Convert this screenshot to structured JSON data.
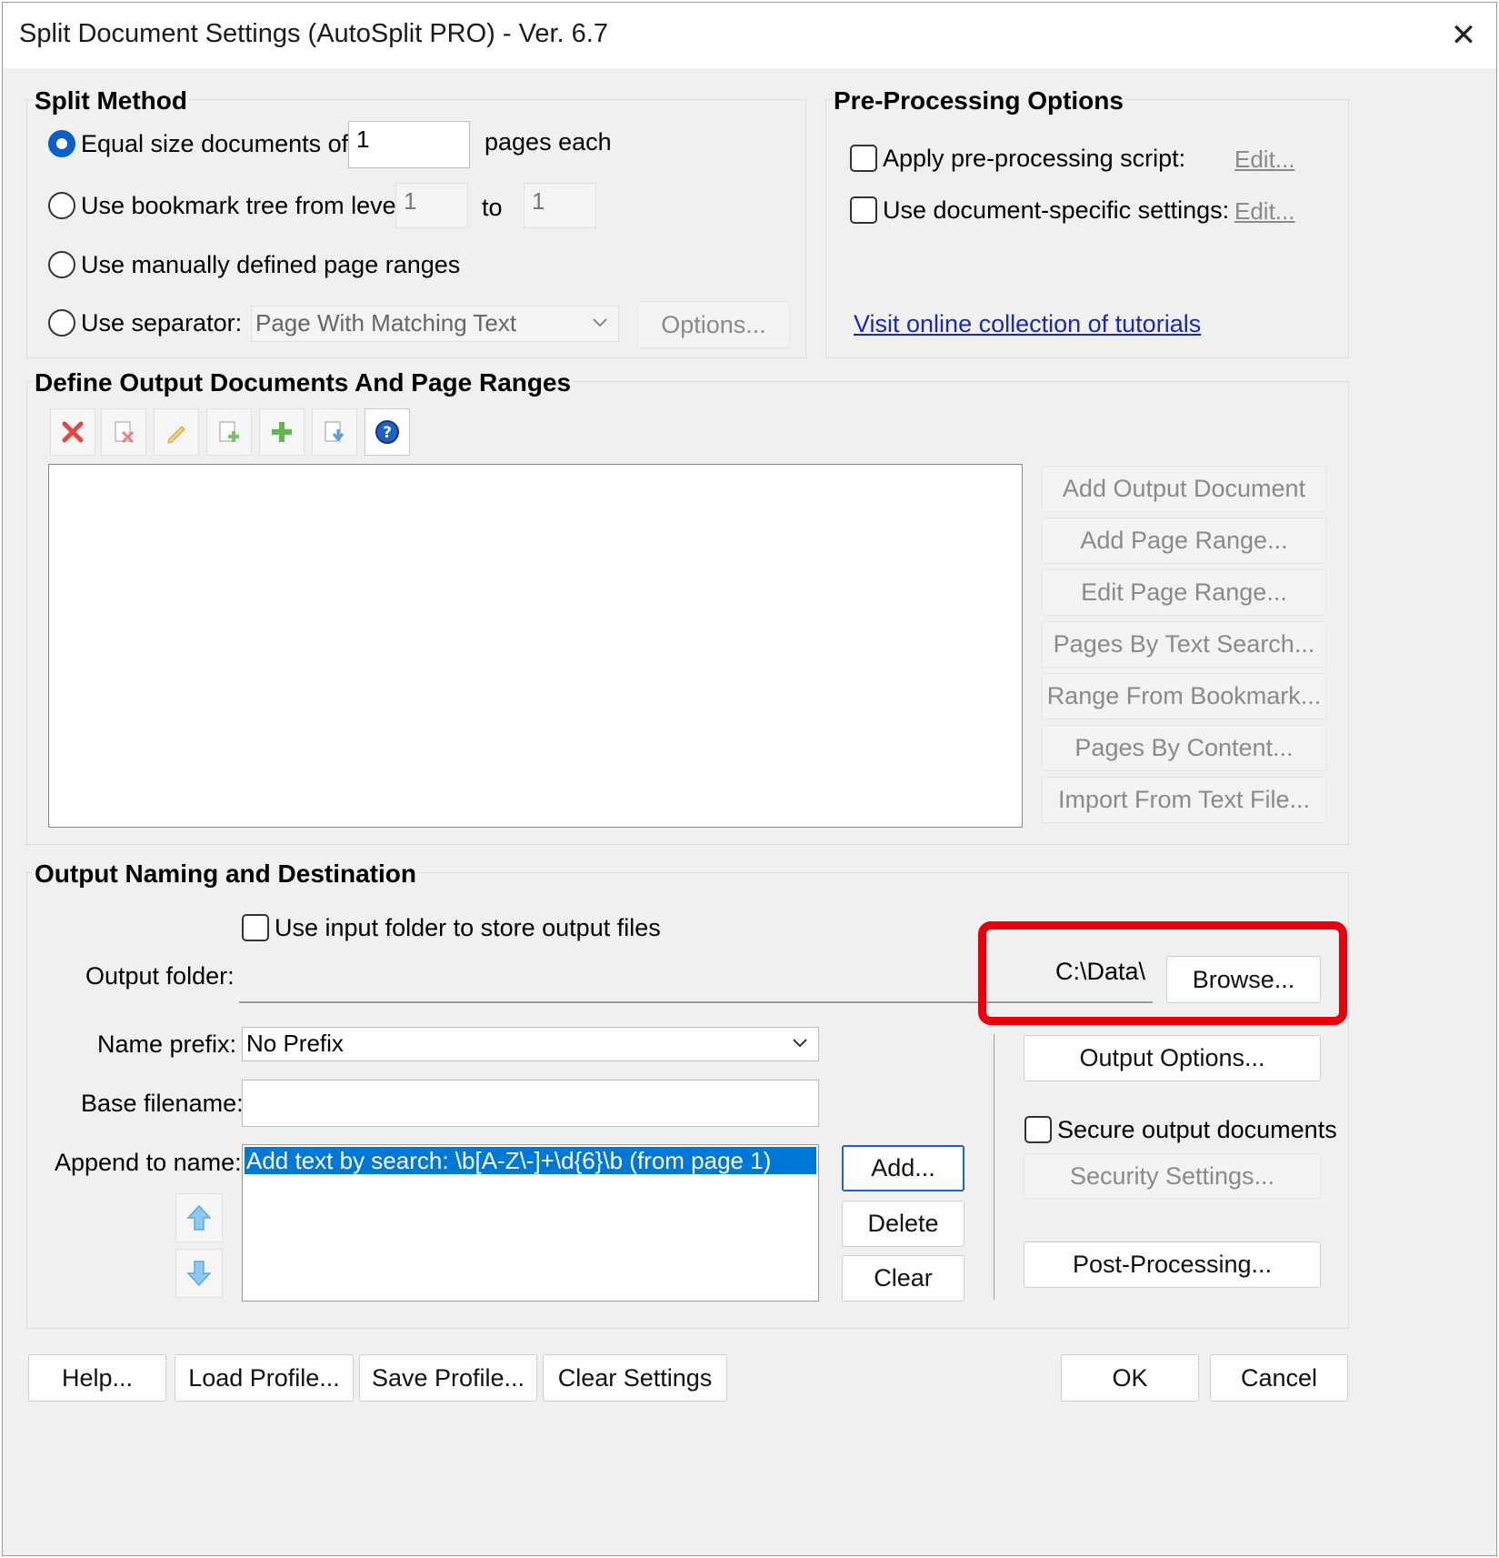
{
  "window": {
    "title": "Split Document Settings (AutoSplit PRO) - Ver. 6.7",
    "close_glyph": "✕"
  },
  "split_method": {
    "title": "Split Method",
    "equal_size_label": "Equal size documents of",
    "equal_size_value": "1",
    "pages_each_label": "pages each",
    "bookmark_label": "Use bookmark tree from level",
    "bookmark_from": "1",
    "to_label": "to",
    "bookmark_to": "1",
    "manual_label": "Use manually defined page ranges",
    "separator_label": "Use separator:",
    "separator_value": "Page With Matching Text",
    "options_button": "Options..."
  },
  "preprocessing": {
    "title": "Pre-Processing Options",
    "script_label": "Apply pre-processing script:",
    "script_edit": "Edit...",
    "doc_specific_label": "Use document-specific settings:",
    "doc_specific_edit": "Edit...",
    "tutorials_link": "Visit online collection of tutorials"
  },
  "define_output": {
    "title": "Define Output Documents And Page Ranges",
    "toolbar_icons": [
      "delete-icon",
      "delete-document-icon",
      "edit-pencil-icon",
      "add-document-icon",
      "add-plus-icon",
      "import-icon",
      "help-icon"
    ],
    "side_buttons": [
      "Add Output Document",
      "Add Page Range...",
      "Edit Page Range...",
      "Pages By Text Search...",
      "Range From Bookmark...",
      "Pages By Content...",
      "Import From Text File..."
    ]
  },
  "output_naming": {
    "title": "Output Naming and Destination",
    "use_input_folder_label": "Use input folder to store output files",
    "output_folder_label": "Output folder:",
    "output_folder_value": "C:\\Data\\",
    "browse_button": "Browse...",
    "name_prefix_label": "Name prefix:",
    "name_prefix_value": "No Prefix",
    "base_filename_label": "Base filename:",
    "base_filename_value": "",
    "append_label": "Append to name:",
    "append_items": [
      "Add text by search: \\b[A-Z\\-]+\\d{6}\\b (from page 1)"
    ],
    "add_button": "Add...",
    "delete_button": "Delete",
    "clear_button": "Clear",
    "output_options_button": "Output Options...",
    "secure_label": "Secure output documents",
    "security_settings_button": "Security Settings...",
    "post_processing_button": "Post-Processing..."
  },
  "footer": {
    "help": "Help...",
    "load_profile": "Load Profile...",
    "save_profile": "Save Profile...",
    "clear_settings": "Clear Settings",
    "ok": "OK",
    "cancel": "Cancel"
  },
  "colors": {
    "highlight": "#e8000b",
    "selection": "#0078d7",
    "link": "#1a2aa8",
    "radio_selected": "#0a5fc8"
  }
}
